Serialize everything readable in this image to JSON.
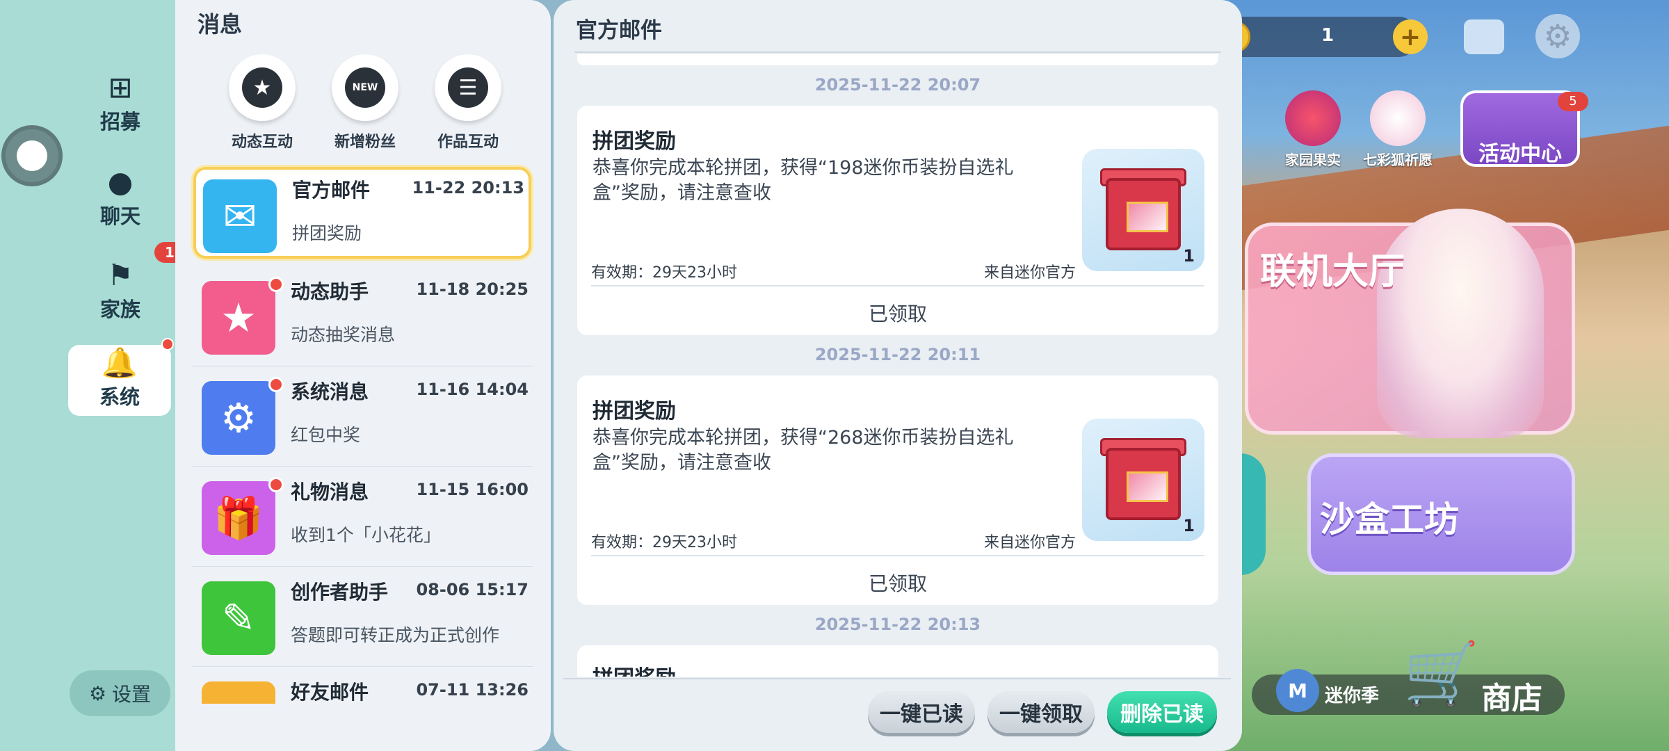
{
  "nav": {
    "items": [
      {
        "label": "招募",
        "icon": "plus-box-icon"
      },
      {
        "label": "聊天",
        "icon": "chat-bubble-icon"
      },
      {
        "label": "家族",
        "icon": "flag-icon"
      },
      {
        "label": "系统",
        "icon": "bell-icon"
      }
    ],
    "family_badge": "1",
    "settings_label": "设置"
  },
  "messages": {
    "title": "消息",
    "quick_actions": [
      {
        "label": "动态互动",
        "icon": "star-chat-icon"
      },
      {
        "label": "新增粉丝",
        "icon": "new-fan-icon",
        "glyph_tag": "NEW"
      },
      {
        "label": "作品互动",
        "icon": "list-icon"
      }
    ],
    "conversations": [
      {
        "name": "官方邮件",
        "time": "11-22 20:13",
        "preview": "拼团奖励",
        "icon": "mail-icon",
        "color": "#34b5ef",
        "unread": false
      },
      {
        "name": "动态助手",
        "time": "11-18 20:25",
        "preview": "动态抽奖消息",
        "icon": "bookmark-star-icon",
        "color": "#f25d8e",
        "unread": true
      },
      {
        "name": "系统消息",
        "time": "11-16 14:04",
        "preview": "红包中奖",
        "icon": "gear-icon",
        "color": "#4f7df0",
        "unread": true
      },
      {
        "name": "礼物消息",
        "time": "11-15 16:00",
        "preview": "收到1个「小花花」",
        "icon": "gift-icon",
        "color": "#cc62ea",
        "unread": true
      },
      {
        "name": "创作者助手",
        "time": "08-06 15:17",
        "preview": "答题即可转正成为正式创作",
        "icon": "pencil-ruler-icon",
        "color": "#3ec53c",
        "unread": false
      },
      {
        "name": "好友邮件",
        "time": "07-11 13:26",
        "preview": "",
        "icon": "friend-mail-icon",
        "color": "#f5b233",
        "unread": false
      }
    ]
  },
  "mail": {
    "title": "官方邮件",
    "entries": [
      {
        "date": "2025-11-22 20:07",
        "title": "拼团奖励",
        "body": "恭喜你完成本轮拼团，获得“198迷你币装扮自选礼盒”奖励，请注意查收",
        "qty": "1",
        "expiry": "有效期：29天23小时",
        "source": "来自迷你官方",
        "status": "已领取"
      },
      {
        "date": "2025-11-22 20:11",
        "title": "拼团奖励",
        "body": "恭喜你完成本轮拼团，获得“268迷你币装扮自选礼盒”奖励，请注意查收",
        "qty": "1",
        "expiry": "有效期：29天23小时",
        "source": "来自迷你官方",
        "status": "已领取"
      },
      {
        "date": "2025-11-22 20:13",
        "title": "拼团奖励"
      }
    ],
    "buttons": {
      "read_all": "一键已读",
      "claim_all": "一键领取",
      "delete_read": "删除已读"
    }
  },
  "game": {
    "coin_count": "1",
    "icons": [
      "家园果实",
      "七彩狐祈愿"
    ],
    "activity_label": "活动中心",
    "activity_badge": "5",
    "lobby_label": "联机大厅",
    "sandbox_label": "沙盒工坊",
    "season_label": "迷你季",
    "shop_label": "商店"
  }
}
